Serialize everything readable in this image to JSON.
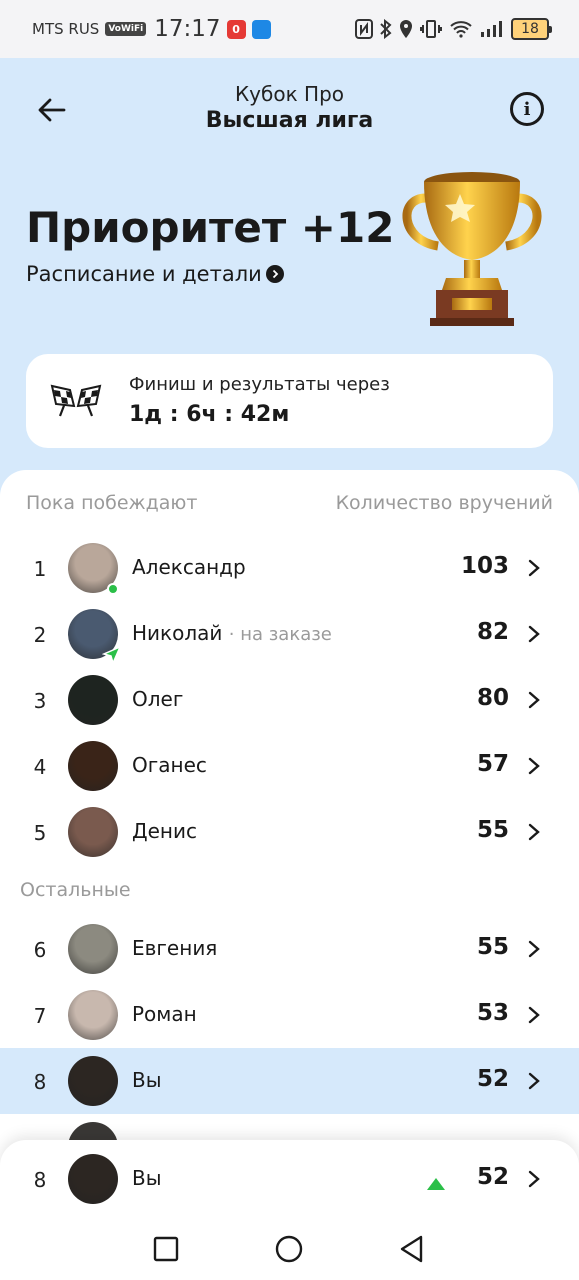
{
  "status_bar": {
    "carrier": "MTS RUS",
    "vowifi": "VoWiFi",
    "time": "17:17",
    "app_badge": "0",
    "battery": "18"
  },
  "header": {
    "subtitle": "Кубок Про",
    "title": "Высшая лига"
  },
  "hero": {
    "title": "Приоритет +12",
    "link": "Расписание и детали"
  },
  "finish": {
    "label": "Финиш и результаты через",
    "time": "1д : 6ч : 42м"
  },
  "leaderboard": {
    "winning_label": "Пока побеждают",
    "count_label": "Количество вручений",
    "others_label": "Остальные",
    "winners": [
      {
        "rank": "1",
        "name": "Александр",
        "note": "",
        "score": "103",
        "avatar_color": "#b9a79a"
      },
      {
        "rank": "2",
        "name": "Николай",
        "note": "· на заказе",
        "score": "82",
        "avatar_color": "#4a5a70"
      },
      {
        "rank": "3",
        "name": "Олег",
        "note": "",
        "score": "80",
        "avatar_color": "#1e2420"
      },
      {
        "rank": "4",
        "name": "Оганес",
        "note": "",
        "score": "57",
        "avatar_color": "#3a2418"
      },
      {
        "rank": "5",
        "name": "Денис",
        "note": "",
        "score": "55",
        "avatar_color": "#7a5a4e"
      }
    ],
    "others": [
      {
        "rank": "6",
        "name": "Евгения",
        "score": "55",
        "avatar_color": "#8c8a80"
      },
      {
        "rank": "7",
        "name": "Роман",
        "score": "53",
        "avatar_color": "#c8b8ae"
      },
      {
        "rank": "8",
        "name": "Вы",
        "score": "52",
        "avatar_color": "#2c2622"
      }
    ]
  },
  "me": {
    "rank": "8",
    "name": "Вы",
    "score": "52",
    "avatar_color": "#2c2622"
  },
  "colors": {
    "background": "#d6e9fb",
    "online": "#2bbf48",
    "trend_up": "#2bbf48"
  }
}
